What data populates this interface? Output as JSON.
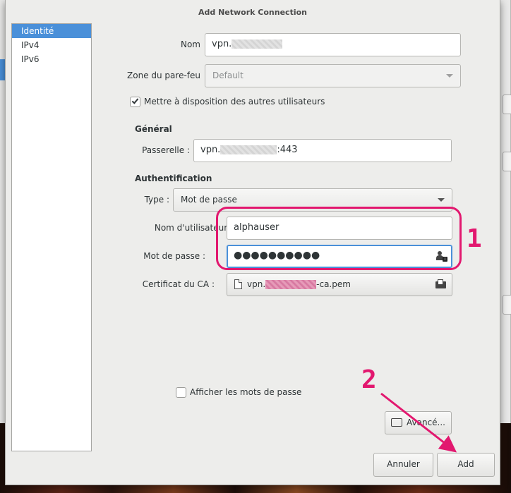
{
  "dialog": {
    "title": "Add Network Connection"
  },
  "sidebar": {
    "items": [
      {
        "label": "Identité",
        "active": true
      },
      {
        "label": "IPv4",
        "active": false
      },
      {
        "label": "IPv6",
        "active": false
      }
    ]
  },
  "form": {
    "name_label": "Nom",
    "name_value_prefix": "vpn.",
    "firewall_label": "Zone du pare-feu",
    "firewall_value": "Default",
    "share_checkbox_label": "Mettre à disposition des autres utilisateurs",
    "share_checked": true,
    "general_title": "Général",
    "gateway_label": "Passerelle :",
    "gateway_prefix": "vpn.",
    "gateway_suffix": ":443",
    "auth_title": "Authentification",
    "type_label": "Type :",
    "type_value": "Mot de passe",
    "username_label": "Nom d'utilisateur :",
    "username_value": "alphauser",
    "password_label": "Mot de passe :",
    "password_mask": "●●●●●●●●●●",
    "ca_label": "Certificat du CA :",
    "ca_prefix": "vpn.",
    "ca_suffix": "-ca.pem",
    "show_passwords_label": "Afficher les mots de passe",
    "show_passwords_checked": false
  },
  "buttons": {
    "advanced": "Avancé...",
    "cancel": "Annuler",
    "add": "Add"
  },
  "annotations": {
    "step1": "1",
    "step2": "2",
    "color": "#e2186f"
  },
  "colors": {
    "accent": "#4a90d9"
  }
}
